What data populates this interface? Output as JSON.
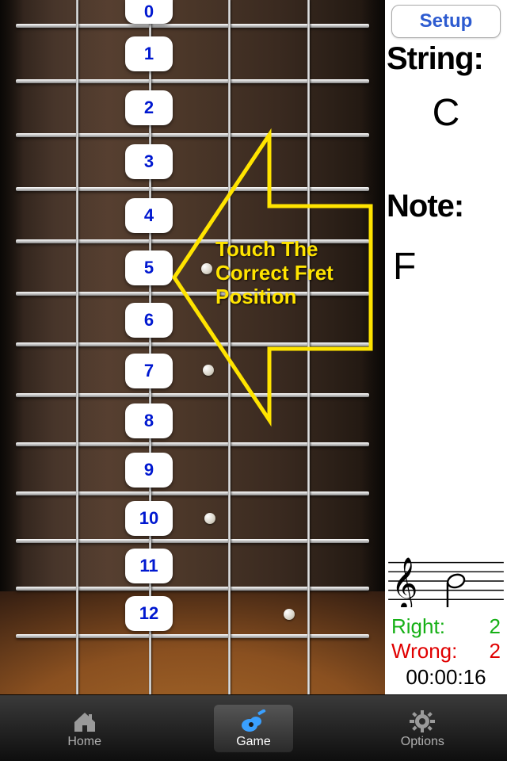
{
  "setup_label": "Setup",
  "string_label": "String:",
  "string_value": "C",
  "note_label": "Note:",
  "note_value": "F",
  "right_label": "Right:",
  "right_value": "2",
  "wrong_label": "Wrong:",
  "wrong_value": "2",
  "timer": "00:00:16",
  "instruction": "Touch The Correct Fret Position",
  "frets": [
    "0",
    "1",
    "2",
    "3",
    "4",
    "5",
    "6",
    "7",
    "8",
    "9",
    "10",
    "11",
    "12"
  ],
  "tabs": {
    "home": "Home",
    "game": "Game",
    "options": "Options"
  },
  "active_tab": "game",
  "colors": {
    "accent_yellow": "#ffe400",
    "right": "#16b016",
    "wrong": "#e00000",
    "fret_number": "#0018d0"
  }
}
